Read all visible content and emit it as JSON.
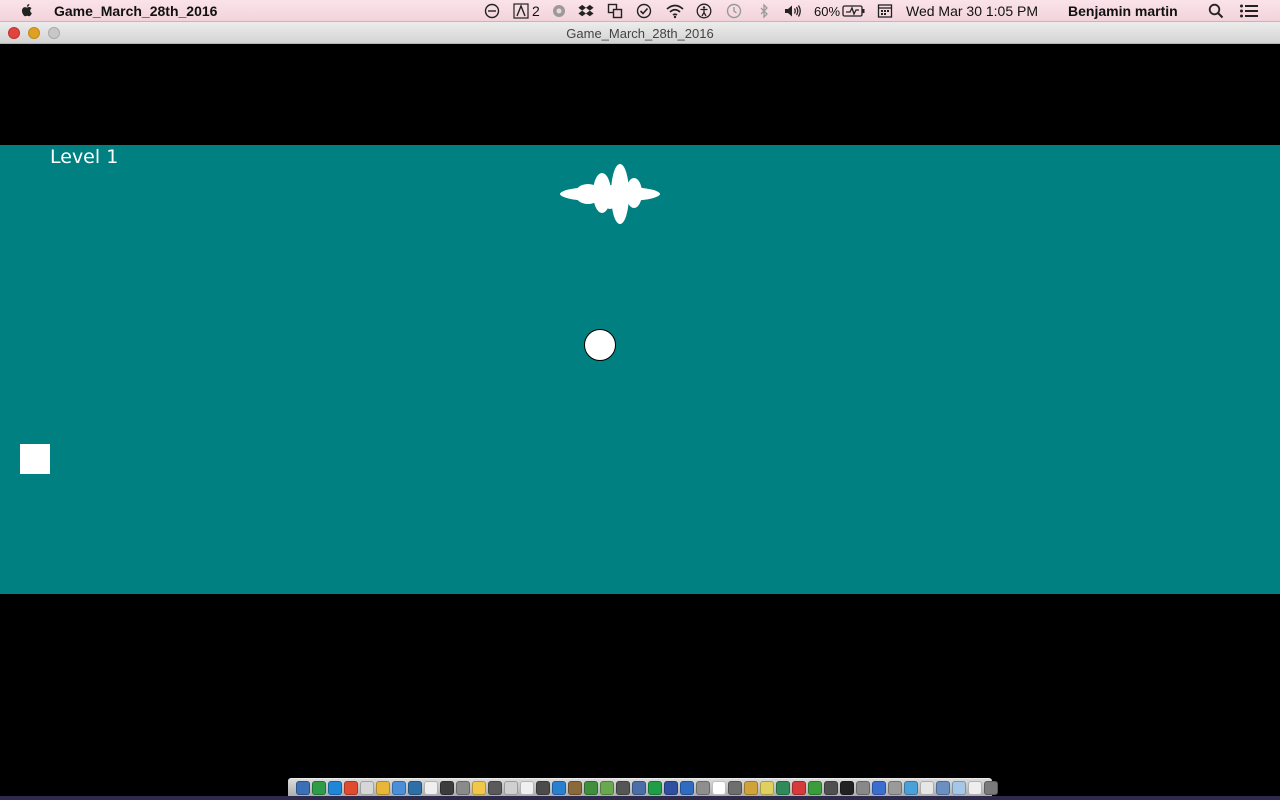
{
  "menubar": {
    "app_name": "Game_March_28th_2016",
    "adobe_badge": "2",
    "battery_percent": "60%",
    "datetime": "Wed Mar 30  1:05 PM",
    "user": "Benjamin martin"
  },
  "window": {
    "title": "Game_March_28th_2016"
  },
  "game": {
    "level_label": "Level 1",
    "background_color": "#008080"
  },
  "dock": {
    "icon_colors": [
      "#3b6fb6",
      "#2f9c4a",
      "#1e87d6",
      "#e04a2f",
      "#d7d7d7",
      "#e8b73a",
      "#4a8fd8",
      "#2f6fa8",
      "#efefef",
      "#3c3c3c",
      "#8a8a8a",
      "#f2c84b",
      "#5a5a5a",
      "#d0d0d0",
      "#f0f0f0",
      "#4b4b4b",
      "#2a7fd1",
      "#8a6a3b",
      "#3f8f3f",
      "#6aa84f",
      "#555555",
      "#4c6ea8",
      "#1f9e47",
      "#2f4fa0",
      "#2e6bc1",
      "#8e8e8e",
      "#ffffff",
      "#6e6e6e",
      "#cfa33a",
      "#e0d060",
      "#2f8b5a",
      "#d63a3a",
      "#3b9c3b",
      "#505050",
      "#222222",
      "#888888",
      "#3a6fd0",
      "#9a9a9a",
      "#4aa0d8",
      "#e6e6e6",
      "#6a8fc0",
      "#a7c7e7",
      "#eeeeee",
      "#7a7a7a"
    ]
  }
}
